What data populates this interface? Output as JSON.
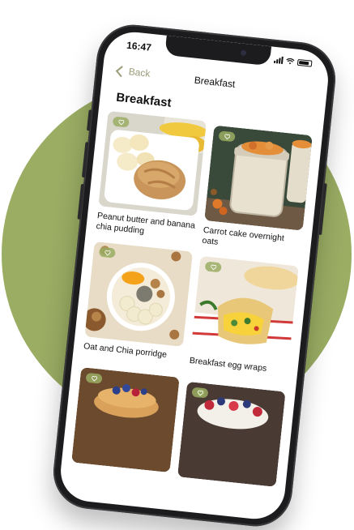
{
  "status_bar": {
    "time": "16:47"
  },
  "nav": {
    "back_label": "Back",
    "title": "Breakfast"
  },
  "page": {
    "heading": "Breakfast"
  },
  "recipes": [
    {
      "name": "Peanut butter and banana chia pudding",
      "icon": "heart-icon"
    },
    {
      "name": "Carrot cake overnight oats",
      "icon": "heart-icon"
    },
    {
      "name": "Oat and Chia porridge",
      "icon": "heart-icon"
    },
    {
      "name": "Breakfast egg wraps",
      "icon": "heart-icon"
    },
    {
      "name": "",
      "icon": "heart-icon"
    },
    {
      "name": "",
      "icon": "heart-icon"
    }
  ],
  "colors": {
    "accent": "#9aad63",
    "back_text": "#9c9c7a",
    "phone_body": "#1c1c1e"
  }
}
